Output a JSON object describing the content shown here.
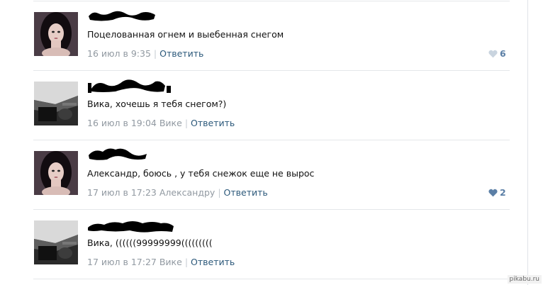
{
  "comments": [
    {
      "text": "Поцелованная огнем и выебенная снегом",
      "date": "16 июл в 9:35",
      "reply_to": "",
      "reply_label": "Ответить",
      "likes": "6",
      "avatar": "girl-photo",
      "liked": false
    },
    {
      "text": "Вика, хочешь я тебя снегом?)",
      "date": "16 июл в 19:04",
      "reply_to": "Вике",
      "reply_label": "Ответить",
      "likes": "",
      "avatar": "car-interior-photo",
      "liked": false
    },
    {
      "text": "Александр, боюсь , у тебя снежок еще не вырос",
      "date": "17 июл в 17:23",
      "reply_to": "Александру",
      "reply_label": "Ответить",
      "likes": "2",
      "avatar": "girl-photo",
      "liked": true
    },
    {
      "text": "Вика, ((((((99999999(((((((((",
      "date": "17 июл в 17:27",
      "reply_to": "Вике",
      "reply_label": "Ответить",
      "likes": "",
      "avatar": "car-interior-photo",
      "liked": false
    }
  ],
  "watermark": "pikabu.ru",
  "colors": {
    "link": "#2b587a",
    "meta": "#9199a1",
    "like": "#5b7fa6"
  }
}
